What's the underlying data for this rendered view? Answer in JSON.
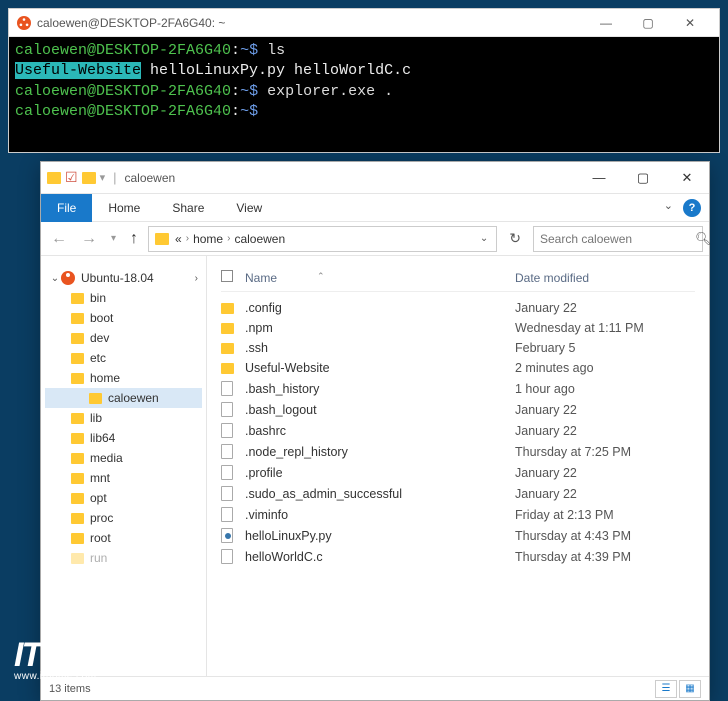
{
  "terminal": {
    "title": "caloewen@DESKTOP-2FA6G40: ~",
    "lines": [
      {
        "type": "prompt",
        "user": "caloewen@DESKTOP-2FA6G40",
        "path": "~$",
        "cmd": "ls"
      },
      {
        "type": "output_ls",
        "highlight": "Useful-Website",
        "rest": "  helloLinuxPy.py  helloWorldC.c"
      },
      {
        "type": "prompt",
        "user": "caloewen@DESKTOP-2FA6G40",
        "path": "~$",
        "cmd": "explorer.exe ."
      },
      {
        "type": "prompt",
        "user": "caloewen@DESKTOP-2FA6G40",
        "path": "~$",
        "cmd": ""
      }
    ]
  },
  "explorer": {
    "title": "caloewen",
    "ribbon": {
      "file": "File",
      "home": "Home",
      "share": "Share",
      "view": "View"
    },
    "breadcrumbs": {
      "seg1": "«",
      "seg2": "home",
      "seg3": "caloewen"
    },
    "search_placeholder": "Search caloewen",
    "sidebar": {
      "root": "Ubuntu-18.04",
      "items": [
        "bin",
        "boot",
        "dev",
        "etc",
        "home"
      ],
      "selected": "caloewen",
      "items2": [
        "lib",
        "lib64",
        "media",
        "mnt",
        "opt",
        "proc",
        "root"
      ],
      "items2_last": "run"
    },
    "columns": {
      "name": "Name",
      "date": "Date modified"
    },
    "files": [
      {
        "name": ".config",
        "type": "folder",
        "date": "January 22"
      },
      {
        "name": ".npm",
        "type": "folder",
        "date": "Wednesday at 1:11 PM"
      },
      {
        "name": ".ssh",
        "type": "folder",
        "date": "February 5"
      },
      {
        "name": "Useful-Website",
        "type": "folder",
        "date": "2 minutes ago"
      },
      {
        "name": ".bash_history",
        "type": "file",
        "date": "1 hour ago"
      },
      {
        "name": ".bash_logout",
        "type": "file",
        "date": "January 22"
      },
      {
        "name": ".bashrc",
        "type": "file",
        "date": "January 22"
      },
      {
        "name": ".node_repl_history",
        "type": "file",
        "date": "Thursday at 7:25 PM"
      },
      {
        "name": ".profile",
        "type": "file",
        "date": "January 22"
      },
      {
        "name": ".sudo_as_admin_successful",
        "type": "file",
        "date": "January 22"
      },
      {
        "name": ".viminfo",
        "type": "file",
        "date": "Friday at 2:13 PM"
      },
      {
        "name": "helloLinuxPy.py",
        "type": "py",
        "date": "Thursday at 4:43 PM"
      },
      {
        "name": "helloWorldC.c",
        "type": "file",
        "date": "Thursday at 4:39 PM"
      }
    ],
    "status": "13 items"
  },
  "watermark": {
    "main": "IT之",
    "sub": "www.ithome.com"
  }
}
